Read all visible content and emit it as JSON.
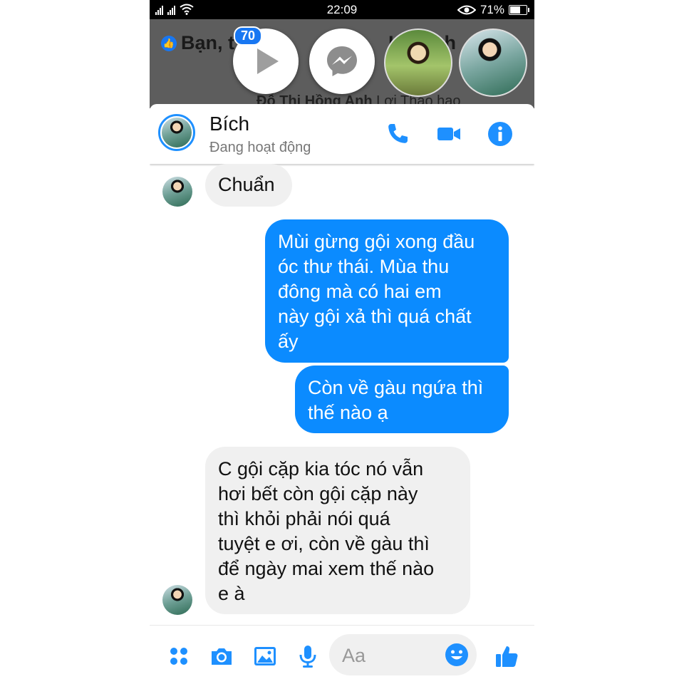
{
  "status_bar": {
    "time": "22:09",
    "battery": "71%",
    "battery_level": 0.71
  },
  "background_screen": {
    "title": "Bạn, t",
    "title_tail": "Hồ",
    "title_tail2": "nh",
    "sub_name": "Đỗ Thị Hồng Anh",
    "sub_text": " Lợi Thảo hạo"
  },
  "chat_heads": {
    "badge": "70",
    "items": [
      "play-icon",
      "messenger-icon",
      "contact-photo",
      "contact-photo"
    ]
  },
  "header": {
    "name": "Bích",
    "status": "Đang hoạt động",
    "icons": [
      "phone-icon",
      "video-camera-icon",
      "info-icon"
    ],
    "accent": "#1e90ff"
  },
  "messages": [
    {
      "from": "them",
      "text": "Chuẩn"
    },
    {
      "from": "me",
      "text": "Mùi gừng gội xong đầu\nóc thư thái. Mùa thu\nđông mà có hai em\nnày gội xả thì quá chất\nấy"
    },
    {
      "from": "me",
      "text": "Còn về gàu ngứa thì\nthế nào ạ"
    },
    {
      "from": "them",
      "text": "C gội cặp kia tóc nó vẫn\nhơi bết còn gội cặp này\nthì khỏi phải nói quá\ntuyệt e ơi, còn về gàu thì\nđể ngày mai xem thế nào\ne à"
    }
  ],
  "composer": {
    "placeholder": "Aa",
    "icons": [
      "apps-icon",
      "camera-icon",
      "image-icon",
      "microphone-icon",
      "emoji-icon",
      "like-icon"
    ]
  },
  "colors": {
    "outgoing": "#0b8bff",
    "incoming": "#f0f0f0",
    "icon": "#1e90ff"
  }
}
